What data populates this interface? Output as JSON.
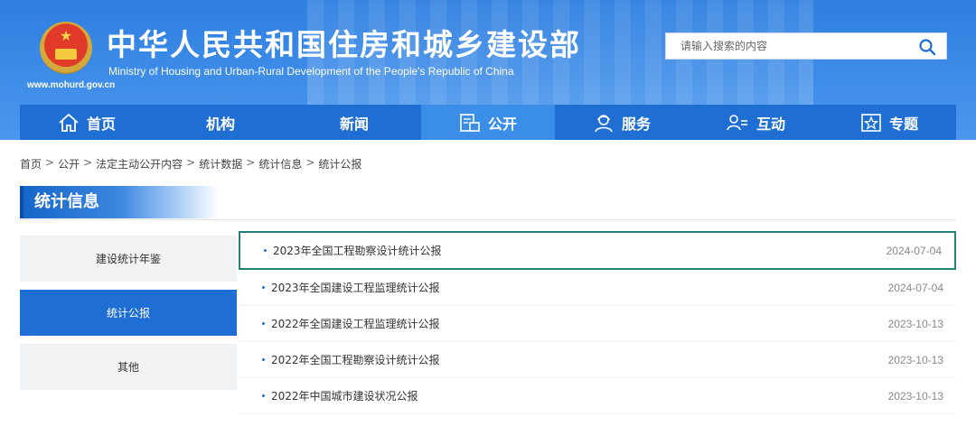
{
  "site": {
    "title_cn": "中华人民共和国住房和城乡建设部",
    "title_en": "Ministry of Housing and Urban-Rural Development of the People's Republic of China",
    "url": "www.mohurd.gov.cn",
    "brand_color": "#1f6ed4"
  },
  "search": {
    "placeholder": "请输入搜索的内容"
  },
  "nav": [
    {
      "label": "首页",
      "icon": "home-icon"
    },
    {
      "label": "机构"
    },
    {
      "label": "新闻"
    },
    {
      "label": "公开",
      "icon": "document-icon",
      "active": true
    },
    {
      "label": "服务",
      "icon": "service-icon"
    },
    {
      "label": "互动",
      "icon": "interaction-icon"
    },
    {
      "label": "专题",
      "icon": "star-icon"
    }
  ],
  "breadcrumb": [
    "首页",
    "公开",
    "法定主动公开内容",
    "统计数据",
    "统计信息",
    "统计公报"
  ],
  "breadcrumb_sep": ">",
  "section_title": "统计信息",
  "sidebar": [
    {
      "label": "建设统计年鉴"
    },
    {
      "label": "统计公报",
      "active": true
    },
    {
      "label": "其他"
    }
  ],
  "list": [
    {
      "title": "2023年全国工程勘察设计统计公报",
      "date": "2024-07-04",
      "selected": true
    },
    {
      "title": "2023年全国建设工程监理统计公报",
      "date": "2024-07-04"
    },
    {
      "title": "2022年全国建设工程监理统计公报",
      "date": "2023-10-13"
    },
    {
      "title": "2022年全国工程勘察设计统计公报",
      "date": "2023-10-13"
    },
    {
      "title": "2022年中国城市建设状况公报",
      "date": "2023-10-13"
    }
  ]
}
